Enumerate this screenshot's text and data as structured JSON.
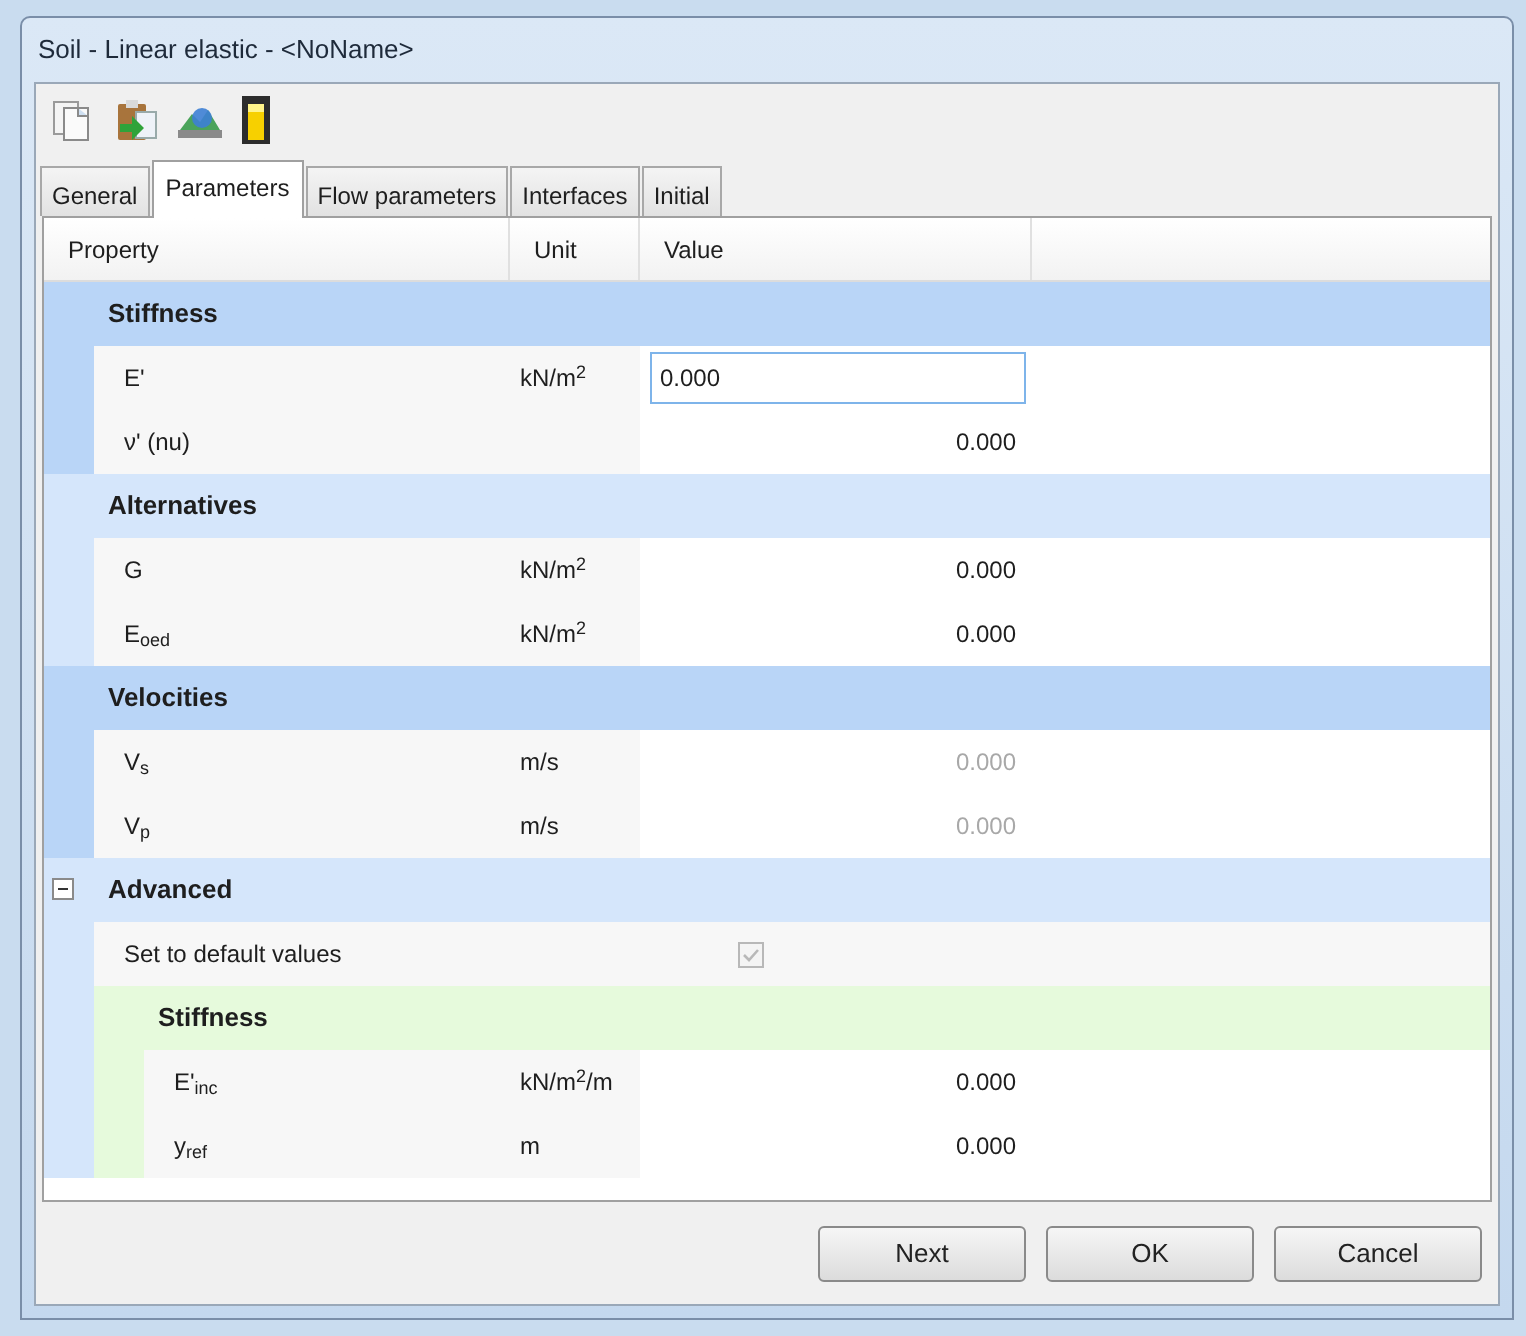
{
  "window": {
    "title": "Soil - Linear elastic - <NoName>"
  },
  "toolbar": [
    {
      "kind": "pages"
    },
    {
      "kind": "paste"
    },
    {
      "kind": "terrain"
    },
    {
      "kind": "column"
    }
  ],
  "tabs": [
    {
      "label": "General",
      "selected": false
    },
    {
      "label": "Parameters",
      "selected": true
    },
    {
      "label": "Flow parameters",
      "selected": false
    },
    {
      "label": "Interfaces",
      "selected": false
    },
    {
      "label": "Initial",
      "selected": false
    }
  ],
  "table": {
    "columns": [
      "Property",
      "Unit",
      "Value"
    ],
    "rows": [
      {
        "kind": "group",
        "label": "Stiffness",
        "color": "#b9d5f7",
        "children": [
          {
            "kind": "input",
            "label": "E'",
            "unit": "kN/m$^{2}$",
            "value": "0.000"
          },
          {
            "kind": "property",
            "label": "ν' (nu)",
            "value": "0.000",
            "disabled": false
          }
        ]
      },
      {
        "kind": "group",
        "label": "Alternatives",
        "color": "#d5e6fb",
        "children": [
          {
            "kind": "property",
            "label": "G",
            "unit": "kN/m$^{2}$",
            "value": "0.000",
            "disabled": false
          },
          {
            "kind": "property",
            "label": "E$_{oed}$",
            "unit": "kN/m$^{2}$",
            "value": "0.000",
            "disabled": false
          }
        ]
      },
      {
        "kind": "group",
        "label": "Velocities",
        "color": "#b9d5f7",
        "children": [
          {
            "kind": "property",
            "label": "V$_{s}$",
            "unit": "m/s",
            "value": "0.000",
            "disabled": true
          },
          {
            "kind": "property",
            "label": "V$_{p}$",
            "unit": "m/s",
            "value": "0.000",
            "disabled": true
          }
        ]
      },
      {
        "kind": "expandable_group",
        "label": "Advanced",
        "color": "#d5e6fb",
        "expanded": true,
        "children": [
          {
            "kind": "checkbox",
            "label": "Set to default values",
            "checked": true,
            "disabled": true
          },
          {
            "kind": "group",
            "label": "Stiffness",
            "color": "#e6fadc",
            "children": [
              {
                "kind": "property",
                "label": "E'$_{inc}$",
                "unit": "kN/m$^{2}$/m",
                "value": "0.000",
                "disabled": false
              },
              {
                "kind": "property",
                "label": "y$_{ref}$",
                "unit": "m",
                "value": "0.000",
                "disabled": false
              }
            ]
          }
        ]
      }
    ]
  },
  "buttons": [
    {
      "label": "Next"
    },
    {
      "label": "OK"
    },
    {
      "label": "Cancel"
    }
  ]
}
